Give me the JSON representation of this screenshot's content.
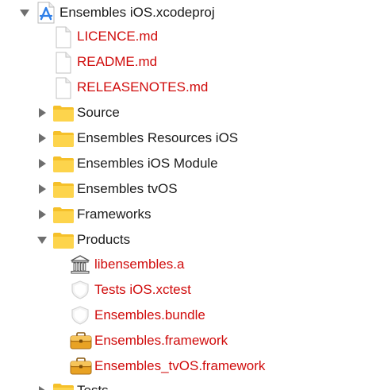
{
  "project": {
    "name": "Ensembles iOS.xcodeproj",
    "icon": "xcode-project-icon",
    "expanded": true
  },
  "files": [
    {
      "name": "LICENCE.md",
      "icon": "document-icon",
      "status": "missing"
    },
    {
      "name": "README.md",
      "icon": "document-icon",
      "status": "missing"
    },
    {
      "name": "RELEASENOTES.md",
      "icon": "document-icon",
      "status": "missing"
    }
  ],
  "groups": [
    {
      "name": "Source",
      "icon": "folder-icon",
      "expanded": false
    },
    {
      "name": "Ensembles Resources iOS",
      "icon": "folder-icon",
      "expanded": false
    },
    {
      "name": "Ensembles iOS Module",
      "icon": "folder-icon",
      "expanded": false
    },
    {
      "name": "Ensembles tvOS",
      "icon": "folder-icon",
      "expanded": false
    },
    {
      "name": "Frameworks",
      "icon": "folder-icon",
      "expanded": false
    },
    {
      "name": "Products",
      "icon": "folder-icon",
      "expanded": true
    },
    {
      "name": "Tests",
      "icon": "folder-icon",
      "expanded": false
    }
  ],
  "products": [
    {
      "name": "libensembles.a",
      "icon": "static-library-icon",
      "status": "missing"
    },
    {
      "name": "Tests iOS.xctest",
      "icon": "test-bundle-icon",
      "status": "missing"
    },
    {
      "name": "Ensembles.bundle",
      "icon": "bundle-icon",
      "status": "missing"
    },
    {
      "name": "Ensembles.framework",
      "icon": "framework-icon",
      "status": "missing"
    },
    {
      "name": "Ensembles_tvOS.framework",
      "icon": "framework-icon",
      "status": "missing"
    }
  ],
  "colors": {
    "missing_text": "#d00c0c",
    "normal_text": "#1b1b1b",
    "folder_yellow": "#fdd44c",
    "disclosure_gray": "#6e6e6e"
  }
}
